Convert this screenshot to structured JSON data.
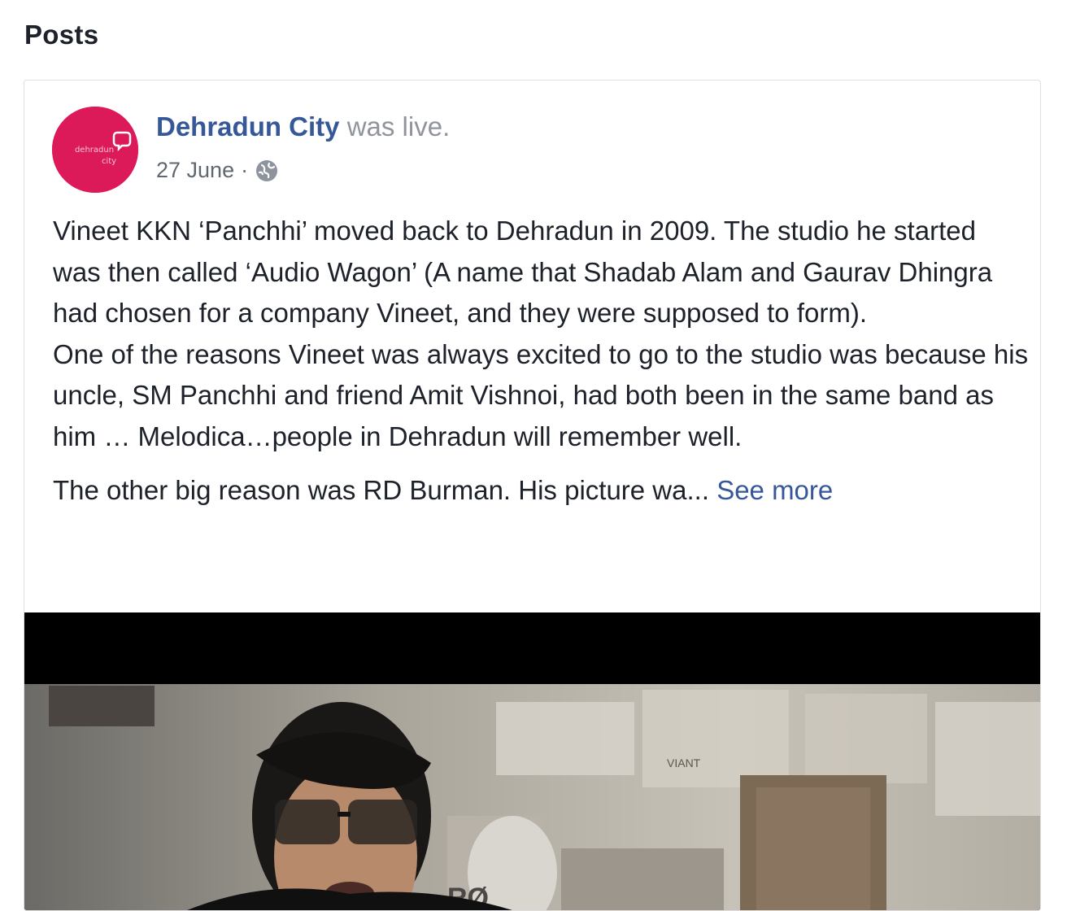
{
  "section": {
    "title": "Posts"
  },
  "post": {
    "page_name": "Dehradun City",
    "status_text": " was live.",
    "date": "27 June",
    "separator": "·",
    "privacy_icon": "globe-icon",
    "avatar": {
      "logo_line1": "dehradun",
      "logo_line2": "city",
      "bg_color": "#dc1a5a"
    },
    "paragraphs": [
      "Vineet KKN ‘Panchhi’ moved back to Dehradun in 2009. The studio he started was then called ‘Audio Wagon’ (A name that Shadab Alam and Gaurav Dhingra had chosen for a company Vineet, and they were supposed to form).",
      "One of the reasons Vineet was always excited to go to the studio was because his uncle, SM Panchhi and friend Amit Vishnoi, had both been in the same band as him … Melodica…people in Dehradun will remember well."
    ],
    "truncated_text": "The other big reason was RD Burman. His picture wa...",
    "see_more_label": "See more",
    "video": {
      "description_icon": "live-video-thumbnail",
      "visible_text": [
        "RØ",
        "VIANT"
      ]
    },
    "colors": {
      "link": "#365899",
      "meta": "#90949c",
      "text": "#1d2129"
    }
  }
}
